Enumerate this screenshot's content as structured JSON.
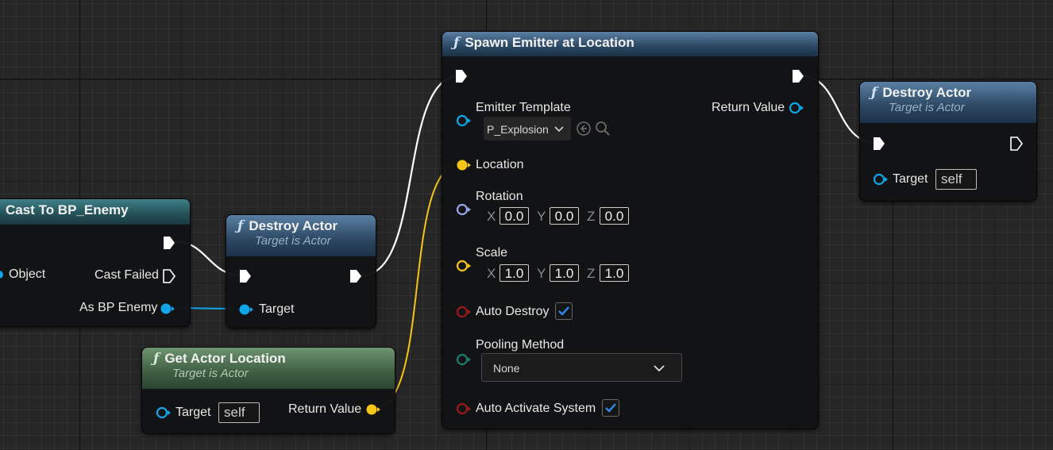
{
  "colors": {
    "exec": "#ffffff",
    "object_pin": "#0ea5e9",
    "vector_pin": "#f5c518",
    "rotator_pin": "#9aa5e8",
    "bool_pin": "#9b1a1a",
    "enum_pin": "#1c7a6e",
    "checkmark": "#2d8cf0"
  },
  "nodes": {
    "cast": {
      "title": "Cast To BP_Enemy",
      "object_label": "Object",
      "cast_failed_label": "Cast Failed",
      "as_bp_enemy_label": "As BP Enemy"
    },
    "destroy_actor_1": {
      "icon": "function-icon",
      "title": "Destroy Actor",
      "subtitle": "Target is Actor",
      "target_label": "Target"
    },
    "get_actor_location": {
      "icon": "function-icon",
      "title": "Get Actor Location",
      "subtitle": "Target is Actor",
      "target_label": "Target",
      "target_value": "self",
      "return_label": "Return Value"
    },
    "spawn_emitter": {
      "icon": "function-icon",
      "title": "Spawn Emitter at Location",
      "emitter_template_label": "Emitter Template",
      "emitter_template_value": "P_Explosion",
      "return_label": "Return Value",
      "location_label": "Location",
      "rotation_label": "Rotation",
      "rotation": {
        "x_label": "X",
        "x": "0.0",
        "y_label": "Y",
        "y": "0.0",
        "z_label": "Z",
        "z": "0.0"
      },
      "scale_label": "Scale",
      "scale": {
        "x_label": "X",
        "x": "1.0",
        "y_label": "Y",
        "y": "1.0",
        "z_label": "Z",
        "z": "1.0"
      },
      "auto_destroy_label": "Auto Destroy",
      "auto_destroy": true,
      "pooling_method_label": "Pooling Method",
      "pooling_method_value": "None",
      "auto_activate_label": "Auto Activate System",
      "auto_activate": true
    },
    "destroy_actor_2": {
      "icon": "function-icon",
      "title": "Destroy Actor",
      "subtitle": "Target is Actor",
      "target_label": "Target",
      "target_value": "self"
    }
  }
}
